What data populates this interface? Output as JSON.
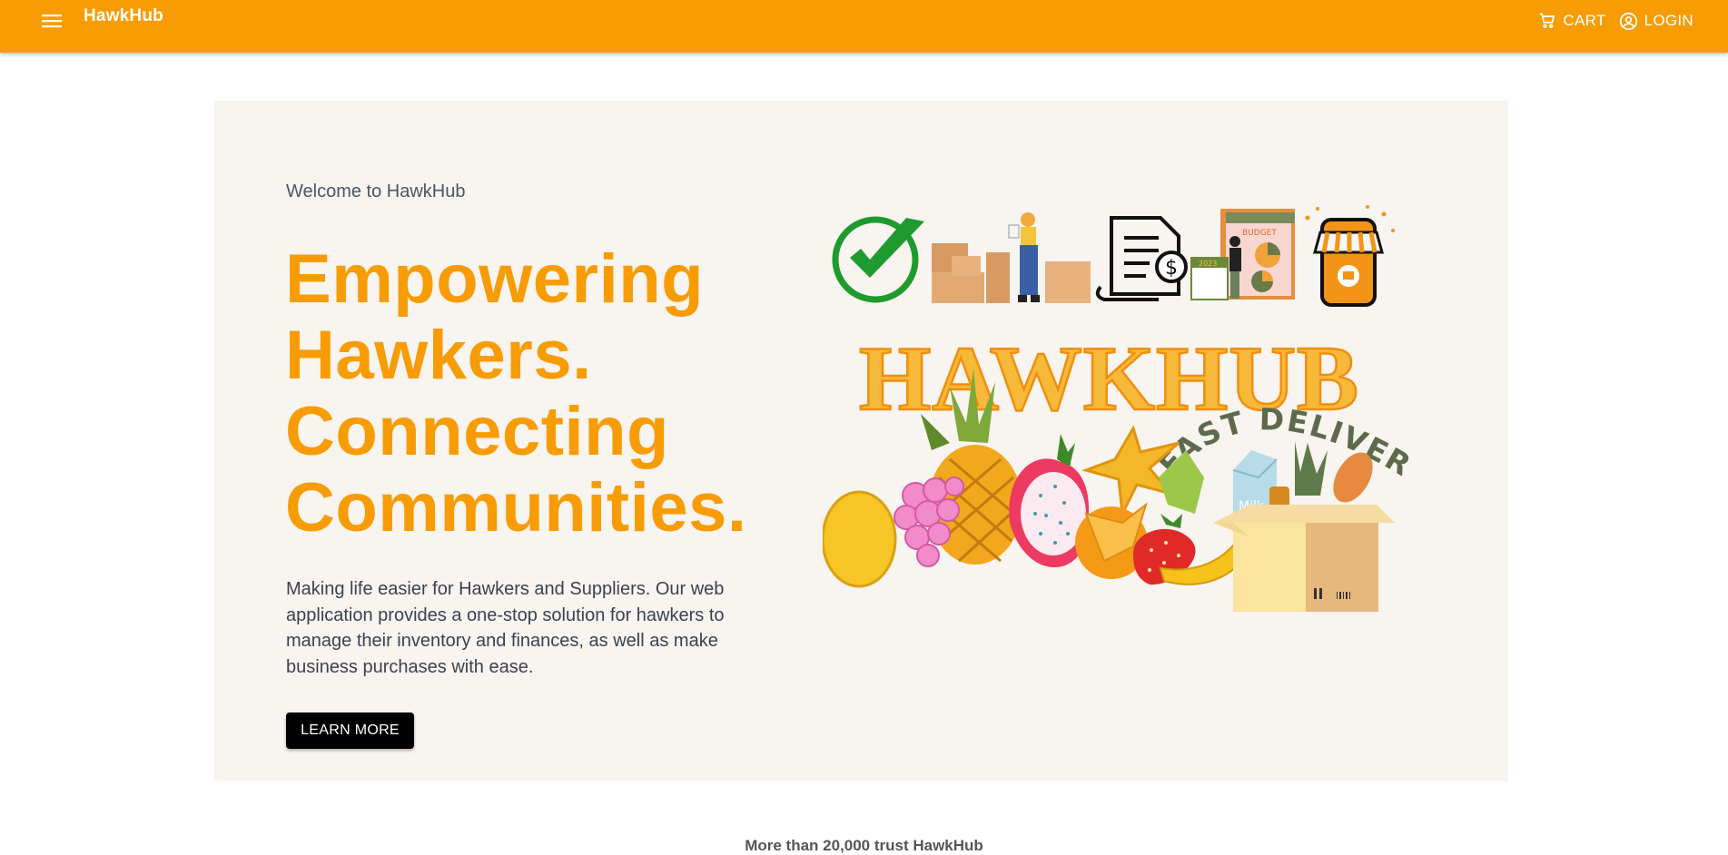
{
  "appbar": {
    "brand": "HawkHub",
    "menu_icon": "hamburger-menu-icon",
    "cart_label": "CART",
    "cart_icon": "shopping-cart-icon",
    "login_label": "LOGIN",
    "login_icon": "account-circle-icon",
    "color": "#f89c05"
  },
  "hero": {
    "welcome": "Welcome to HawkHub",
    "headline": [
      "Empowering",
      "Hawkers.",
      "Connecting",
      "Communities."
    ],
    "description": "Making life easier for Hawkers and Suppliers. Our web application provides a one-stop solution for hawkers to manage their inventory and finances, as well as make business purchases with ease.",
    "cta_label": "LEARN MORE",
    "illustration": {
      "logo_text": "HAWKHUB",
      "tagline": "FAST DELIVERY",
      "poster_label": "BUDGET",
      "calendar_label": "2023",
      "carton_label": "Milk",
      "icons": [
        "checkmark-icon",
        "warehouse-worker-boxes-icon",
        "invoice-dollar-icon",
        "budget-report-icon",
        "mobile-shop-icon"
      ]
    }
  },
  "footer_peek": {
    "stat_text": "More than 20,000 trust HawkHub"
  }
}
